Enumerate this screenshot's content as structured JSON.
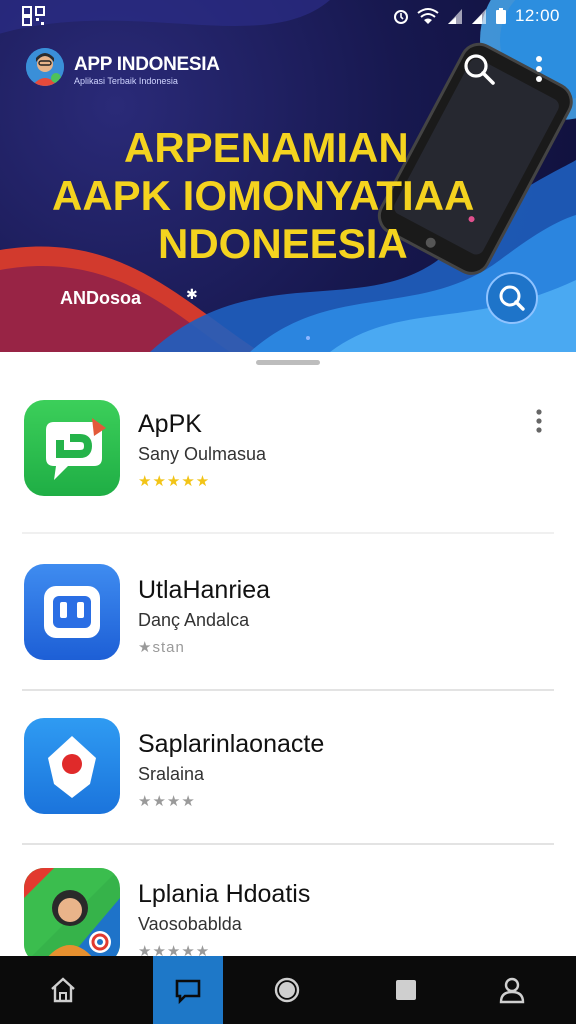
{
  "status_bar": {
    "time": "12:00",
    "left_icon": "qr-code-icon",
    "right_icons": [
      "alarm-icon",
      "wifi-icon",
      "signal-icon",
      "signal-icon",
      "battery-icon"
    ]
  },
  "app_bar": {
    "title": "APP INDONESIA",
    "subtitle": "Aplikasi Terbaik Indonesia",
    "search_icon": "search-icon",
    "more_icon": "more-vert-icon"
  },
  "hero": {
    "headline_lines": [
      "ARPENAMIAN",
      "AAPK IOMONYATIAA",
      "NDONEESIA"
    ],
    "tag": "ANDosoa",
    "fab_icon": "search-icon"
  },
  "apps": [
    {
      "name": "ApPK",
      "developer": "Sany Oulmasua",
      "rating_text": "★★★★★",
      "icon": "chat-bubble-app-icon",
      "has_menu": true
    },
    {
      "name": "UtlaHanriea",
      "developer": "Danç Andalca",
      "rating_text": "★stan",
      "icon": "square-app-icon"
    },
    {
      "name": "Saplarinlaonacte",
      "developer": "Sralaina",
      "rating_text": "★★★★",
      "icon": "location-pin-app-icon"
    },
    {
      "name": "Lplania Hdoatis",
      "developer": "Vaosobablda",
      "rating_text": "★★★★★",
      "icon": "portrait-app-icon"
    }
  ],
  "bottom_nav": [
    {
      "icon": "home-icon",
      "active": false
    },
    {
      "icon": "chat-icon",
      "active": true
    },
    {
      "icon": "circle-icon",
      "active": false
    },
    {
      "icon": "square-icon",
      "active": false
    },
    {
      "icon": "profile-icon",
      "active": false
    }
  ],
  "colors": {
    "hero_bg": "#17184f",
    "headline": "#f4d31f",
    "accent_blue": "#1e78c8",
    "star": "#f2c417",
    "nav_bg": "#0b0b0b"
  }
}
